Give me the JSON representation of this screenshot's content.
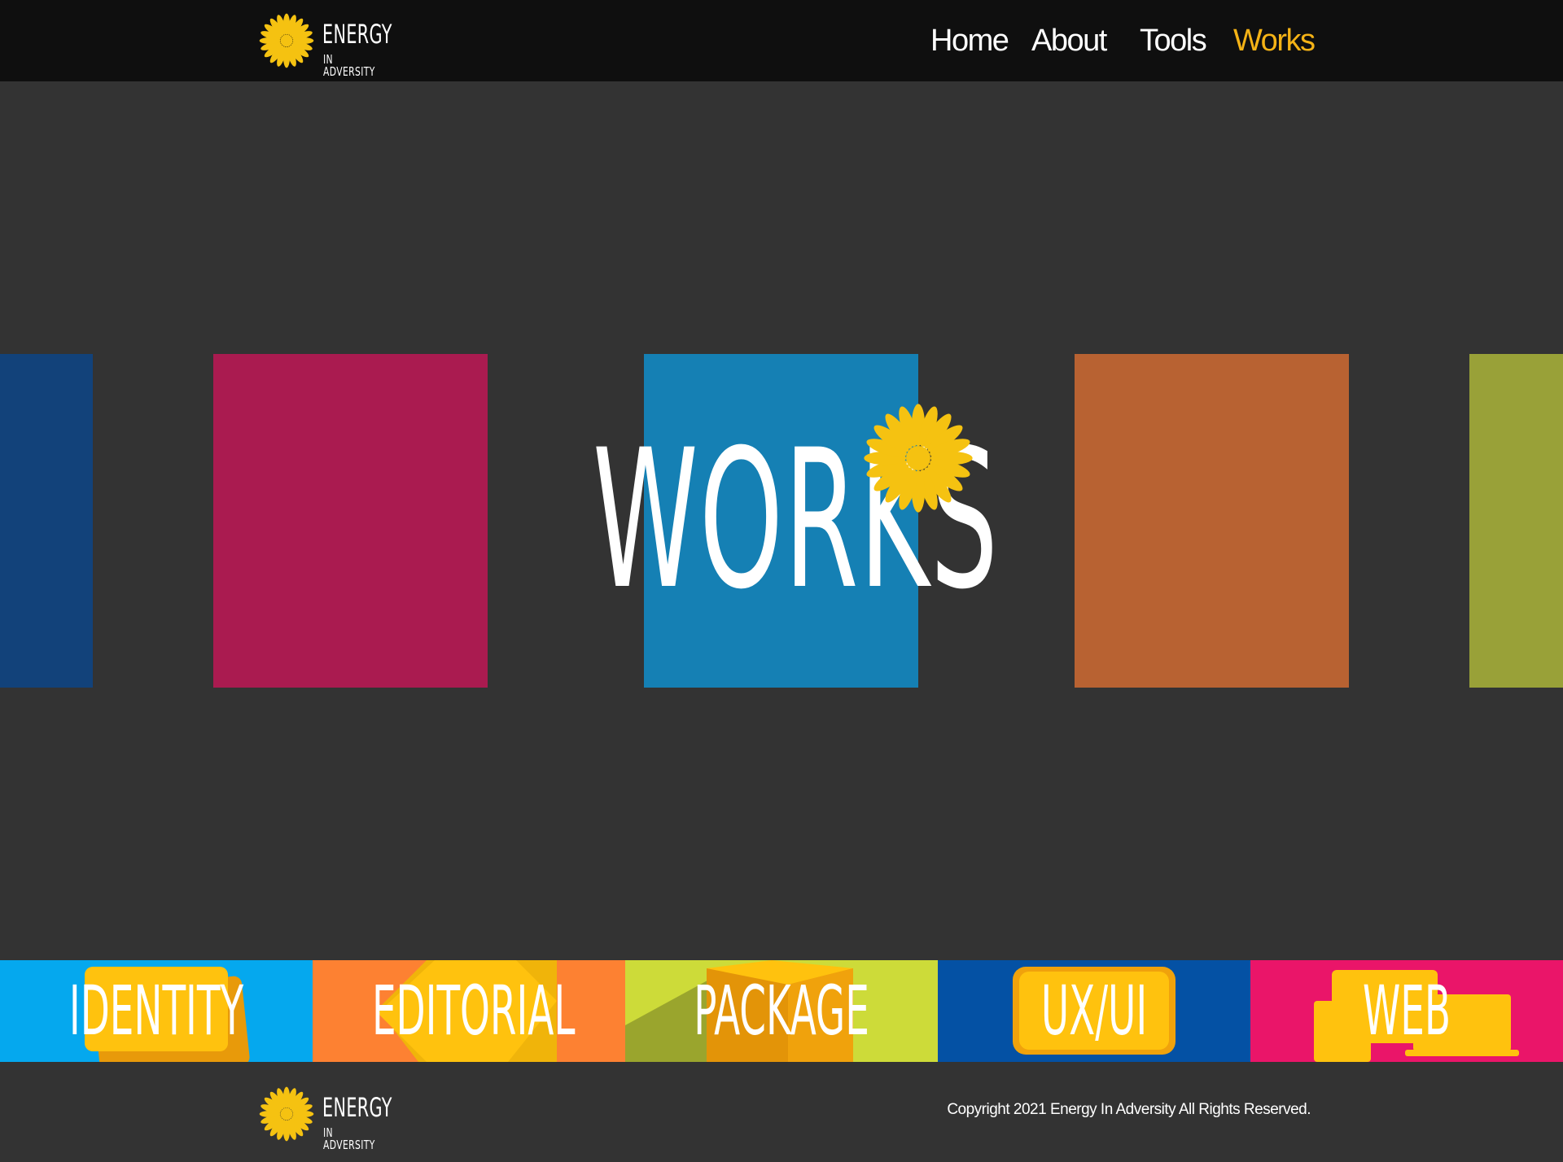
{
  "brand": {
    "name_line1": "ENERGY",
    "name_line2": "IN ADVERSITY",
    "flower_color": "#f5c211"
  },
  "nav": {
    "items": [
      {
        "label": "Home",
        "active": false
      },
      {
        "label": "About",
        "active": false
      },
      {
        "label": "Tools",
        "active": false
      },
      {
        "label": "Works",
        "active": true
      }
    ],
    "active_color": "#f5b316"
  },
  "hero": {
    "title": "WORKS",
    "tile_colors": [
      "#12427a",
      "#aa1b50",
      "#1580b4",
      "#b86232",
      "#99a138"
    ]
  },
  "categories": [
    {
      "label": "IDENTITY",
      "background": "#05a8ee",
      "icon": "id-card-icon"
    },
    {
      "label": "EDITORIAL",
      "background": "#fd8132",
      "icon": "open-book-icon"
    },
    {
      "label": "PACKAGE",
      "background": "#cddb39",
      "icon": "box-icon"
    },
    {
      "label": "UX/UI",
      "background": "#0451a4",
      "icon": "phone-icon"
    },
    {
      "label": "WEB",
      "background": "#ea1569",
      "icon": "devices-icon"
    }
  ],
  "footer": {
    "copyright": "Copyright 2021 Energy In Adversity All Rights Reserved."
  }
}
